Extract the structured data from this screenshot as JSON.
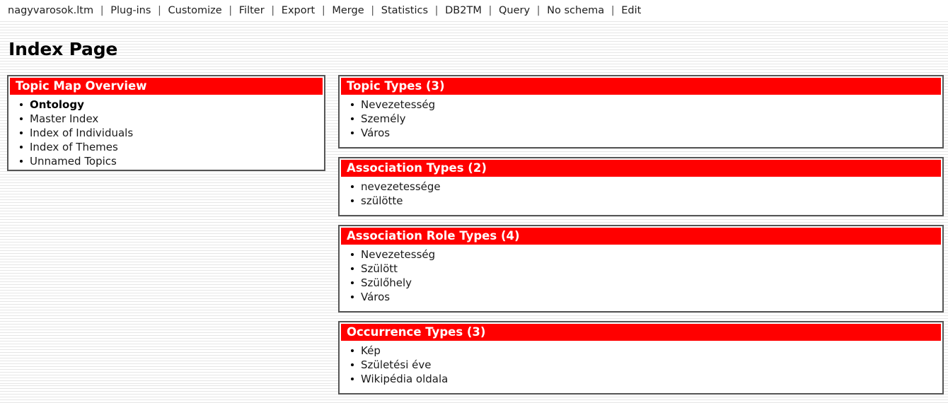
{
  "menubar": {
    "separator": "|",
    "items": [
      {
        "label": "nagyvarosok.ltm"
      },
      {
        "label": "Plug-ins"
      },
      {
        "label": "Customize"
      },
      {
        "label": "Filter"
      },
      {
        "label": "Export"
      },
      {
        "label": "Merge"
      },
      {
        "label": "Statistics"
      },
      {
        "label": "DB2TM"
      },
      {
        "label": "Query"
      },
      {
        "label": "No schema"
      },
      {
        "label": "Edit"
      }
    ]
  },
  "page": {
    "title": "Index Page",
    "accent_color": "#ff0000",
    "border_color": "#555555",
    "header_text_color": "#ffffff"
  },
  "left_column": {
    "panels": [
      {
        "title": "Topic Map Overview",
        "items": [
          {
            "label": "Ontology",
            "bold": true
          },
          {
            "label": "Master Index",
            "bold": false
          },
          {
            "label": "Index of Individuals",
            "bold": false
          },
          {
            "label": "Index of Themes",
            "bold": false
          },
          {
            "label": "Unnamed Topics",
            "bold": false
          }
        ]
      }
    ]
  },
  "right_column": {
    "panels": [
      {
        "title": "Topic Types (3)",
        "count": 3,
        "items": [
          {
            "label": "Nevezetesség"
          },
          {
            "label": "Személy"
          },
          {
            "label": "Város"
          }
        ]
      },
      {
        "title": "Association Types (2)",
        "count": 2,
        "items": [
          {
            "label": "nevezetessége"
          },
          {
            "label": "szülötte"
          }
        ]
      },
      {
        "title": "Association Role Types (4)",
        "count": 4,
        "items": [
          {
            "label": "Nevezetesség"
          },
          {
            "label": "Szülött"
          },
          {
            "label": "Szülőhely"
          },
          {
            "label": "Város"
          }
        ]
      },
      {
        "title": "Occurrence Types (3)",
        "count": 3,
        "items": [
          {
            "label": "Kép"
          },
          {
            "label": "Születési éve"
          },
          {
            "label": "Wikipédia oldala"
          }
        ]
      }
    ]
  }
}
